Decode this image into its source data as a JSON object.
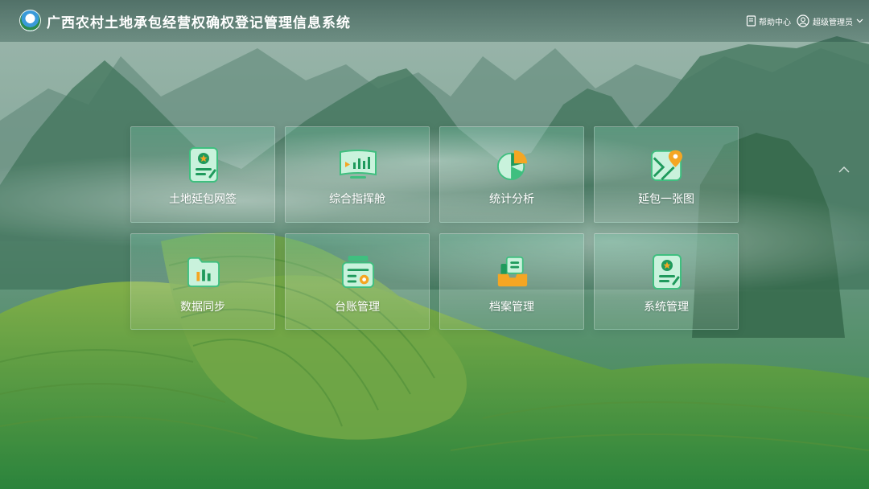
{
  "header": {
    "title": "广西农村土地承包经营权确权登记管理信息系统",
    "help_label": "帮助中心",
    "user_label": "超级管理员"
  },
  "tiles": [
    {
      "label": "土地延包网签",
      "icon": "certificate-star-icon"
    },
    {
      "label": "综合指挥舱",
      "icon": "dashboard-screen-icon"
    },
    {
      "label": "统计分析",
      "icon": "pie-chart-icon"
    },
    {
      "label": "延包一张图",
      "icon": "map-pin-icon"
    },
    {
      "label": "数据同步",
      "icon": "folder-sync-icon"
    },
    {
      "label": "台账管理",
      "icon": "ledger-icon"
    },
    {
      "label": "档案管理",
      "icon": "archive-icon"
    },
    {
      "label": "系统管理",
      "icon": "system-certificate-icon"
    }
  ],
  "colors": {
    "icon_green_light": "#c9f2dc",
    "icon_green": "#3fbf7f",
    "icon_green_dark": "#1f9a5c",
    "icon_orange": "#f5a623"
  }
}
